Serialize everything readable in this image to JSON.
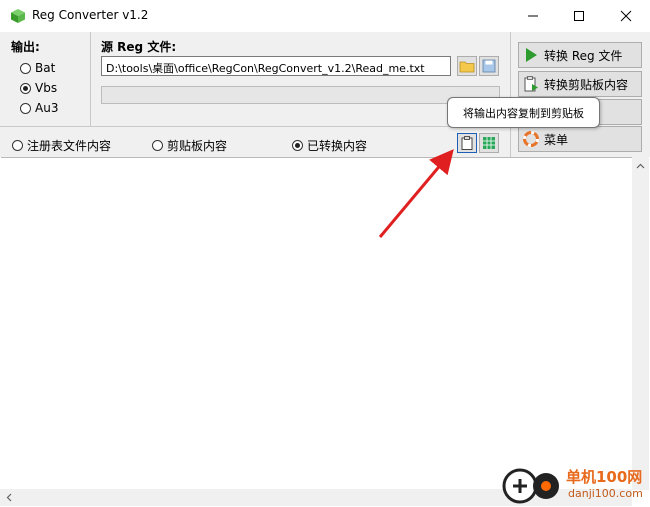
{
  "window": {
    "title": "Reg Converter v1.2"
  },
  "output": {
    "label": "输出:",
    "options": [
      "Bat",
      "Vbs",
      "Au3"
    ],
    "selected": "Vbs"
  },
  "source": {
    "label": "源 Reg 文件:",
    "path": "D:\\tools\\桌面\\office\\RegCon\\RegConvert_v1.2\\Read_me.txt"
  },
  "view": {
    "options": [
      "注册表文件内容",
      "剪贴板内容",
      "已转换内容"
    ],
    "selected": "已转换内容"
  },
  "actions": {
    "convert_reg": "转换 Reg 文件",
    "convert_clipboard": "转换剪贴板内容",
    "menu": "菜单"
  },
  "tooltip": {
    "text": "将输出内容复制到剪贴板"
  },
  "watermark": {
    "brand": "单机100网",
    "url": "danji100.com"
  },
  "colors": {
    "accent_green": "#2e9b2e",
    "arrow_red": "#e02020",
    "menu_orange": "#e8742a"
  }
}
